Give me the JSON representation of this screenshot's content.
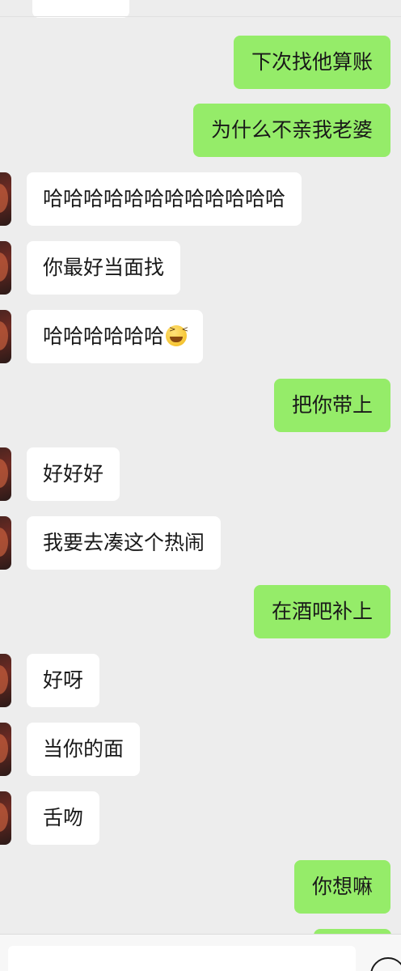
{
  "messages": [
    {
      "side": "out",
      "text": "下次找他算账"
    },
    {
      "side": "out",
      "text": "为什么不亲我老婆"
    },
    {
      "side": "in",
      "text": "哈哈哈哈哈哈哈哈哈哈哈哈"
    },
    {
      "side": "in",
      "text": "你最好当面找"
    },
    {
      "side": "in",
      "text": "哈哈哈哈哈哈",
      "emoji": "laughing-squint"
    },
    {
      "side": "out",
      "text": "把你带上"
    },
    {
      "side": "in",
      "text": "好好好"
    },
    {
      "side": "in",
      "text": "我要去凑这个热闹"
    },
    {
      "side": "out",
      "text": "在酒吧补上"
    },
    {
      "side": "in",
      "text": "好呀"
    },
    {
      "side": "in",
      "text": "当你的面"
    },
    {
      "side": "in",
      "text": "舌吻"
    },
    {
      "side": "out",
      "text": "你想嘛"
    }
  ],
  "colors": {
    "background": "#ededed",
    "outgoing_bubble": "#95ec69",
    "incoming_bubble": "#ffffff",
    "text": "#191919"
  },
  "icons": {
    "emoji": "laughing-squint-emoji",
    "input_voice": "voice-icon"
  }
}
